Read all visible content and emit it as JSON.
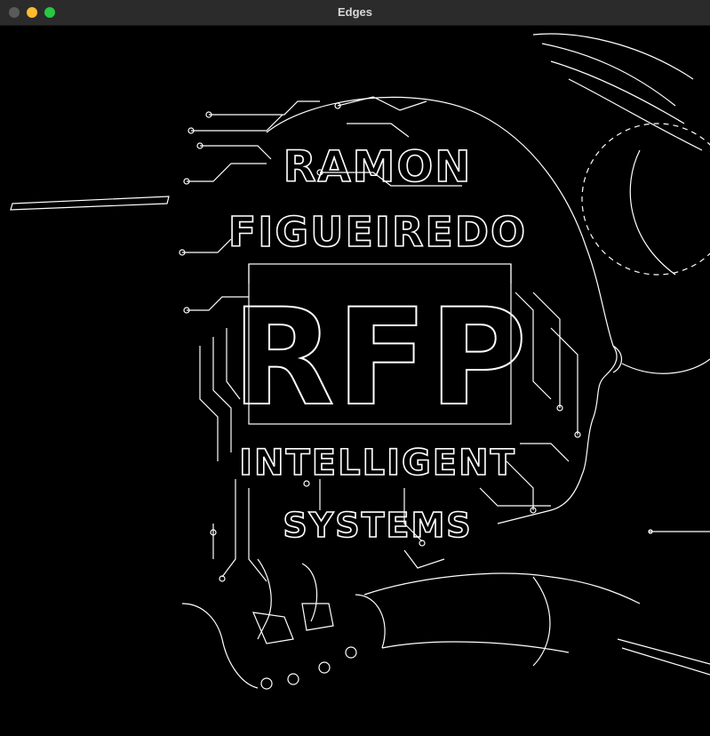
{
  "window": {
    "title": "Edges",
    "controls": {
      "close_color": "#5a5a5a",
      "minimize_color": "#febc2e",
      "maximize_color": "#28c840"
    }
  },
  "artwork": {
    "name_line1": "RAMON",
    "name_line2": "FIGUEIREDO",
    "monogram": "RFP",
    "tagline_line1": "INTELLIGENT",
    "tagline_line2": "SYSTEMS",
    "stroke_color": "#ffffff",
    "background_color": "#000000"
  }
}
